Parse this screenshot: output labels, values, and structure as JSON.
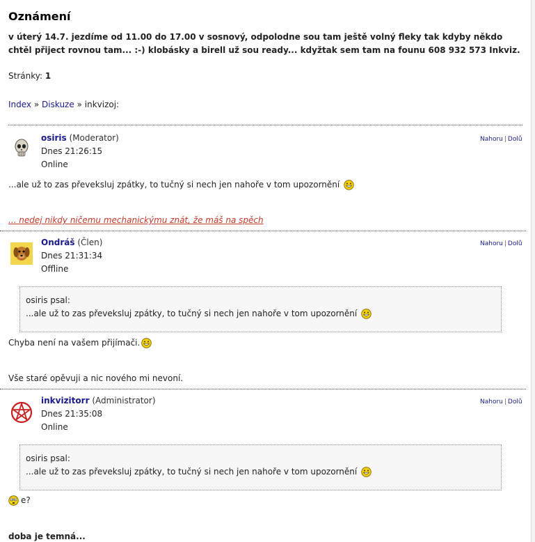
{
  "announcement": {
    "title": "Oznámení",
    "text": "v úterý 14.7. jezdíme od 11.00 do 17.00 v sosnový, odpolodne sou tam ještě volný fleky tak kdyby někdo chtěl přiject rovnou tam... :-) klobásky a birell už sou ready... kdyžtak sem tam na founu 608 932 573 Inkviz."
  },
  "pages": {
    "label": "Stránky:",
    "current": "1"
  },
  "breadcrumb": {
    "index": "Index",
    "sep1": "»",
    "discussion": "Diskuze",
    "sep2": "»",
    "topic": "inkvizoj:"
  },
  "nav": {
    "up": "Nahoru",
    "pipe": "|",
    "down": "Dolů"
  },
  "posts": [
    {
      "author": "osiris",
      "role": "(Moderator)",
      "time": "Dnes 21:26:15",
      "status": "Online",
      "avatar_icon": "skull-icon",
      "body": "...ale už to zas převeksluj zpátky, to tučný si nech jen nahoře v tom upozornění",
      "signature": "... nedej nikdy ničemu mechanickýmu znát, že máš na spěch"
    },
    {
      "author": "Ondráš",
      "role": "(Člen)",
      "time": "Dnes 21:31:34",
      "status": "Offline",
      "avatar_icon": "dog-icon",
      "quote_author": "osiris psal:",
      "quote_text": "...ale už to zas převeksluj zpátky, to tučný si nech jen nahoře v tom upozornění",
      "body": "Chyba není na vašem přijímači.",
      "signature": "Vše staré opěvuji a nic nového mi nevoní."
    },
    {
      "author": "inkvizitorr",
      "role": "(Administrator)",
      "time": "Dnes 21:35:08",
      "status": "Online",
      "avatar_icon": "pentagram-icon",
      "quote_author": "osiris psal:",
      "quote_text": "...ale už to zas převeksluj zpátky, to tučný si nech jen nahoře v tom upozornění",
      "body": "e?",
      "signature": "doba je temná..."
    }
  ],
  "colors": {
    "link": "#1a1a8c",
    "signature": "#c0392b",
    "smiley": "#f5d000"
  }
}
